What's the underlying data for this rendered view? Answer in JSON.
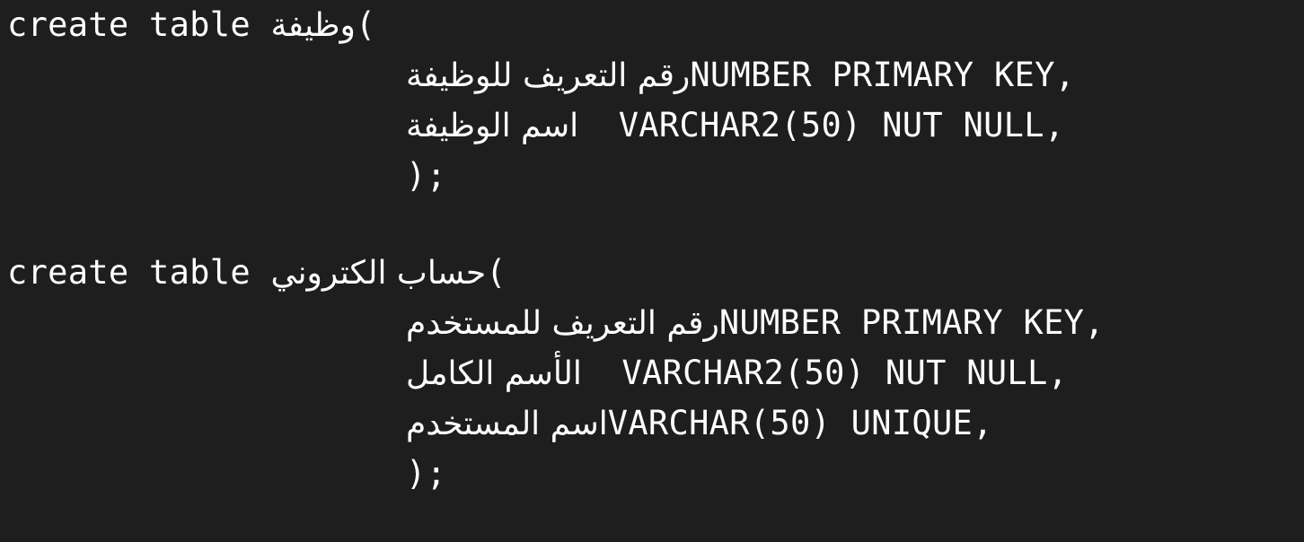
{
  "code": {
    "table1": {
      "header_kw": "create table ",
      "name": "وظيفة",
      "open_paren": "(",
      "col1_name": "رقم التعريف للوظيفة",
      "col1_def": "NUMBER PRIMARY KEY,",
      "col2_name": "اسم الوظيفة",
      "col2_def": "  VARCHAR2(50) NUT NULL,",
      "close": ");"
    },
    "table2": {
      "header_kw": "create table ",
      "name": "حساب الكتروني",
      "open_paren": "(",
      "col1_name": "رقم التعريف للمستخدم",
      "col1_def": "NUMBER PRIMARY KEY,",
      "col2_name": "الأسم الكامل",
      "col2_def": "  VARCHAR2(50) NUT NULL,",
      "col3_name": "اسم المستخدم",
      "col3_def": "VARCHAR(50) UNIQUE,",
      "close": ");"
    }
  }
}
